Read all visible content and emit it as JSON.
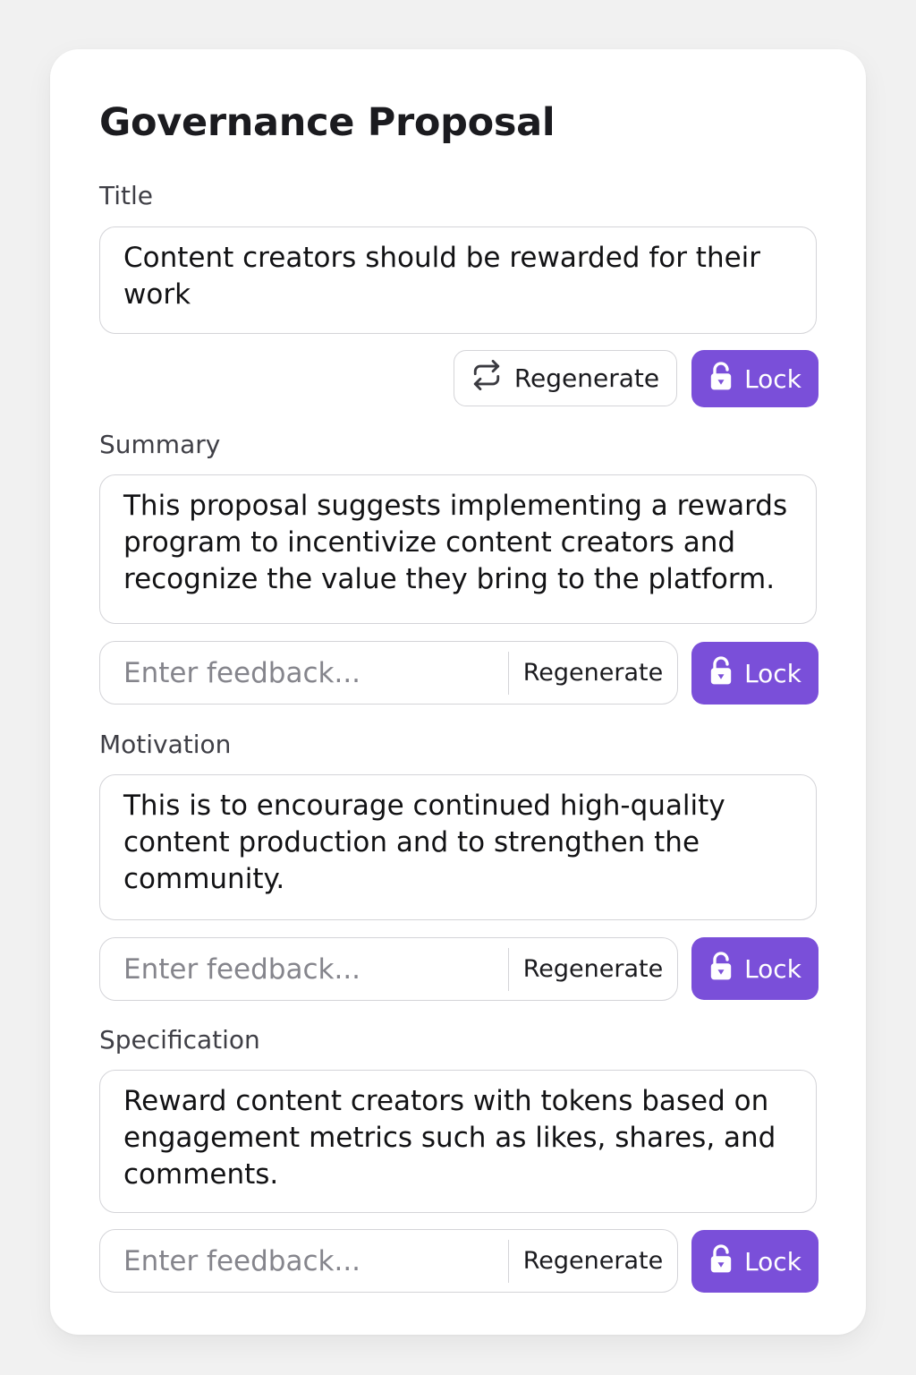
{
  "page": {
    "title": "Governance Proposal"
  },
  "sections": {
    "title": {
      "label": "Title",
      "value": "Content creators should be rewarded for their\nwork",
      "regenerate_label": "Regenerate",
      "lock_label": "Lock"
    },
    "summary": {
      "label": "Summary",
      "value": "This proposal suggests implementing a rewards\nprogram to incentivize content creators and\nrecognize the value they bring to the platform.",
      "feedback_placeholder": "Enter feedback...",
      "regenerate_label": "Regenerate",
      "lock_label": "Lock"
    },
    "motivation": {
      "label": "Motivation",
      "value": "This is to encourage continued high-quality\ncontent production and to strengthen the\ncommunity.",
      "feedback_placeholder": "Enter feedback...",
      "regenerate_label": "Regenerate",
      "lock_label": "Lock"
    },
    "specification": {
      "label": "Specification",
      "value": "Reward content creators with tokens based on\nengagement metrics such as likes, shares, and\ncomments.",
      "feedback_placeholder": "Enter feedback...",
      "regenerate_label": "Regenerate",
      "lock_label": "Lock"
    }
  },
  "icons": {
    "regenerate": "refresh-icon",
    "lock": "lock-icon"
  },
  "colors": {
    "accent": "#7a4fd9",
    "border": "#d4d4d8",
    "background": "#f1f1f1",
    "card": "#ffffff"
  }
}
